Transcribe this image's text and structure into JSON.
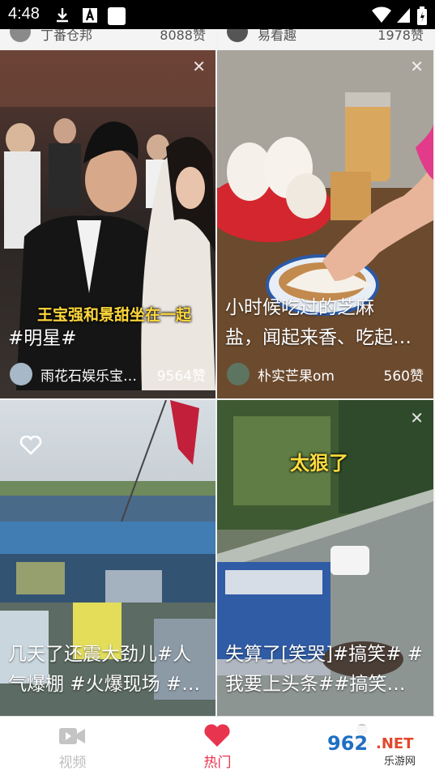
{
  "status": {
    "time": "4:48"
  },
  "top_partial": {
    "left_author": "丁番仓邦",
    "left_likes": "8088赞",
    "right_author": "易看趣",
    "right_likes": "1978赞"
  },
  "cards": [
    {
      "overlay": "王宝强和景甜坐在一起",
      "caption": "#明星#",
      "author": "雨花石娱乐宝…",
      "likes": "9564赞"
    },
    {
      "caption_line1": "小时候吃过的芝麻",
      "caption_line2": "盐，闻起来香、吃起…",
      "author": "朴实芒果om",
      "likes": "560赞"
    },
    {
      "caption_line1": "几天了还震大劲儿#人",
      "caption_line2": "气爆棚 #火爆现场 #…"
    },
    {
      "overlay": "太狠了",
      "caption_line1": "失算了[笑哭]#搞笑# #",
      "caption_line2": "我要上头条##搞笑…"
    }
  ],
  "tabs": [
    {
      "label": "视频",
      "icon": "video-icon",
      "color": "#bdbdbd"
    },
    {
      "label": "热门",
      "icon": "heart-icon",
      "color": "#e8344f"
    },
    {
      "label": "",
      "icon": "profile-icon",
      "color": "#bdbdbd"
    }
  ],
  "watermark": {
    "brand": "962.NET",
    "sub": "乐游网"
  }
}
